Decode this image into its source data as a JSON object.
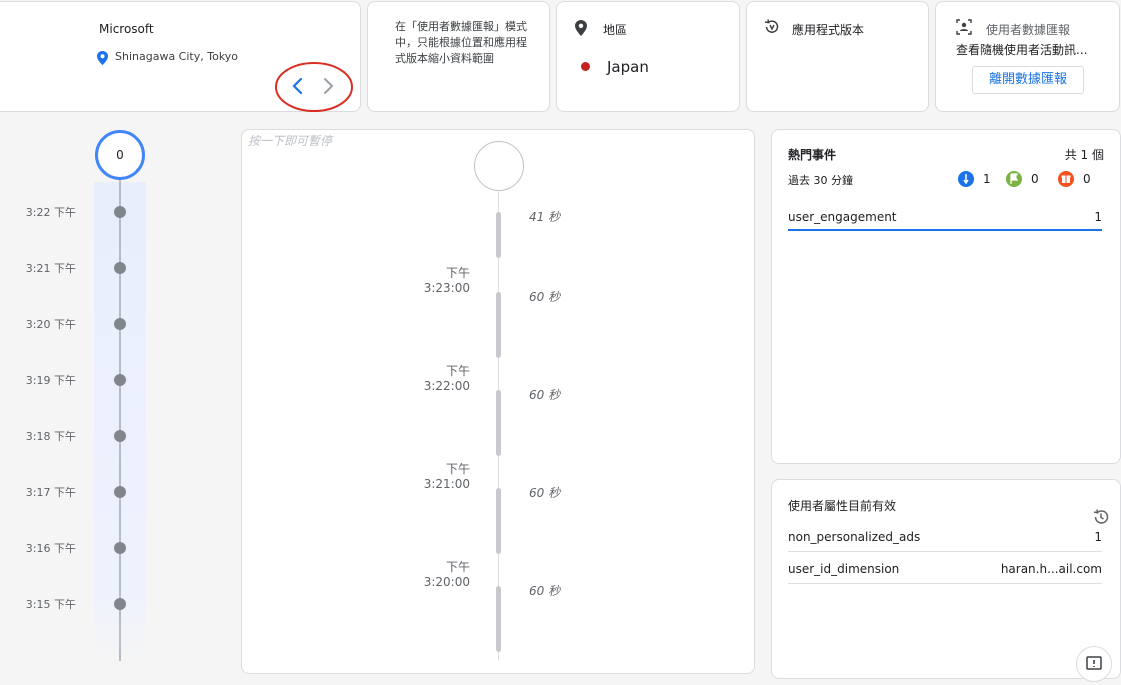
{
  "device_card": {
    "brand": "Microsoft",
    "location": "Shinagawa City, Tokyo"
  },
  "note_card": {
    "text": "在「使用者數據匯報」模式中，只能根據位置和應用程式版本縮小資料範圍"
  },
  "region_card": {
    "label": "地區",
    "value": "Japan"
  },
  "appver_card": {
    "label": "應用程式版本"
  },
  "explorer_card": {
    "label": "使用者數據匯報",
    "desc": "查看隨機使用者活動訊...",
    "button": "離開數據匯報"
  },
  "rail": {
    "counter": "0",
    "times": [
      "3:22 下午",
      "3:21 下午",
      "3:20 下午",
      "3:19 下午",
      "3:18 下午",
      "3:17 下午",
      "3:16 下午",
      "3:15 下午"
    ]
  },
  "stream": {
    "hint": "按一下即可暫停",
    "durations": [
      "41 秒",
      "60 秒",
      "60 秒",
      "60 秒",
      "60 秒"
    ],
    "times": [
      "下午3:23:00",
      "下午3:22:00",
      "下午3:21:00",
      "下午3:20:00"
    ]
  },
  "top_events": {
    "title": "熱門事件",
    "total": "共 1 個",
    "period": "過去 30 分鐘",
    "counts": {
      "blue": "1",
      "green": "0",
      "orange": "0"
    },
    "rows": [
      {
        "name": "user_engagement",
        "value": "1"
      }
    ]
  },
  "user_props": {
    "title": "使用者屬性目前有效",
    "rows": [
      {
        "name": "non_personalized_ads",
        "value": "1"
      },
      {
        "name": "user_id_dimension",
        "value": "haran.h...ail.com"
      }
    ]
  },
  "colors": {
    "accent": "#1a73e8",
    "circle_annotation": "#d93025",
    "japan_dot": "#c5221f"
  }
}
